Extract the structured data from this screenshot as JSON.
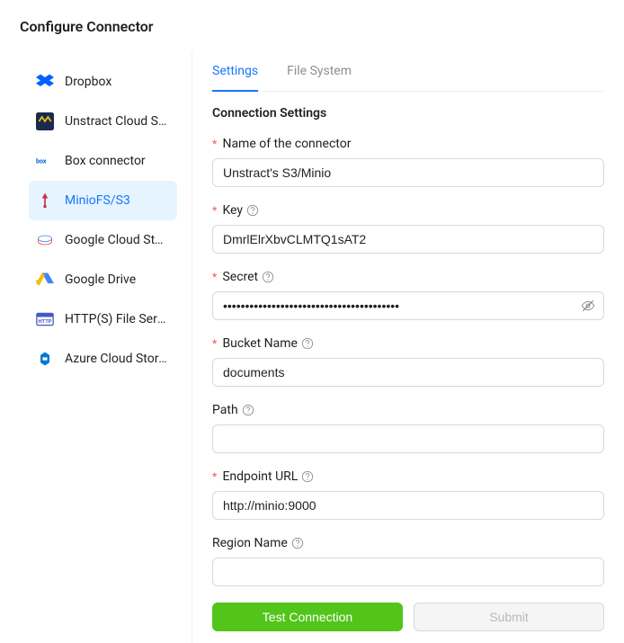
{
  "page_title": "Configure Connector",
  "sidebar": {
    "items": [
      {
        "label": "Dropbox"
      },
      {
        "label": "Unstract Cloud Storage"
      },
      {
        "label": "Box connector"
      },
      {
        "label": "MinioFS/S3"
      },
      {
        "label": "Google Cloud Storage"
      },
      {
        "label": "Google Drive"
      },
      {
        "label": "HTTP(S) File Server"
      },
      {
        "label": "Azure Cloud Storage"
      }
    ]
  },
  "tabs": {
    "settings": "Settings",
    "filesystem": "File System"
  },
  "form": {
    "section_title": "Connection Settings",
    "name_label": "Name of the connector",
    "name_value": "Unstract's S3/Minio",
    "key_label": "Key",
    "key_value": "DmrlElrXbvCLMTQ1sAT2",
    "secret_label": "Secret",
    "secret_value": "••••••••••••••••••••••••••••••••••••••••",
    "bucket_label": "Bucket Name",
    "bucket_value": "documents",
    "path_label": "Path",
    "path_value": "",
    "endpoint_label": "Endpoint URL",
    "endpoint_value": "http://minio:9000",
    "region_label": "Region Name",
    "region_value": "",
    "test_button": "Test Connection",
    "submit_button": "Submit"
  }
}
